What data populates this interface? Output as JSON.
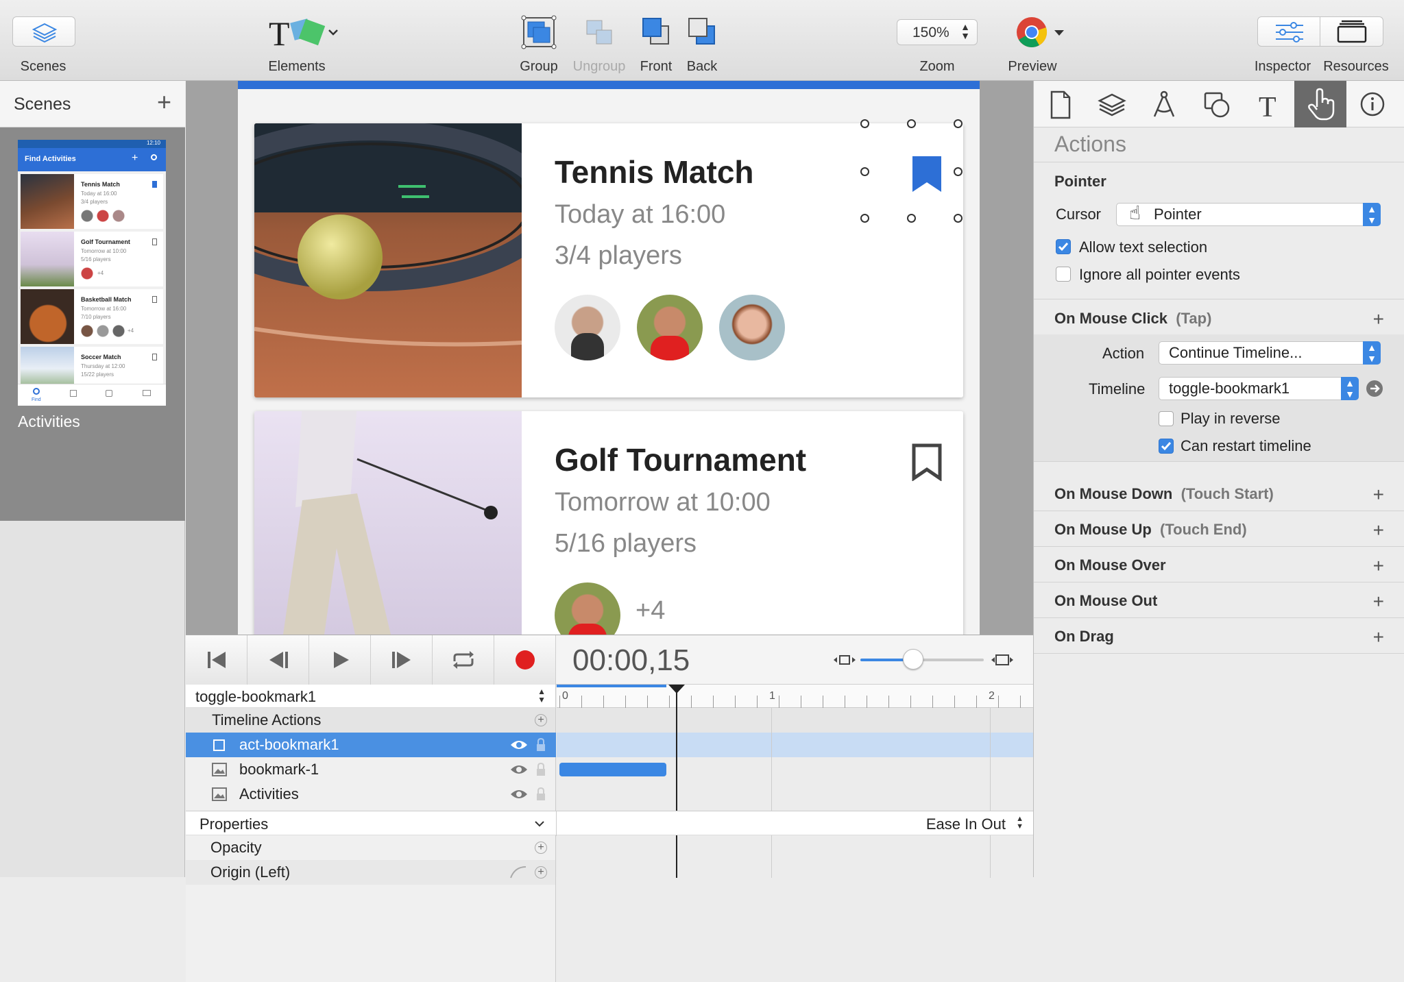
{
  "toolbar": {
    "scenes_label": "Scenes",
    "elements_label": "Elements",
    "group_label": "Group",
    "ungroup_label": "Ungroup",
    "front_label": "Front",
    "back_label": "Back",
    "zoom_value": "150%",
    "zoom_label": "Zoom",
    "preview_label": "Preview",
    "inspector_label": "Inspector",
    "resources_label": "Resources"
  },
  "scenes": {
    "header": "Scenes",
    "scene_name": "Activities",
    "thumb": {
      "time": "12:10",
      "title": "Find Activities",
      "items": [
        {
          "title": "Tennis Match",
          "line1": "Today at 16:00",
          "line2": "3/4 players"
        },
        {
          "title": "Golf Tournament",
          "line1": "Tomorrow at 10:00",
          "line2": "5/16 players"
        },
        {
          "title": "Basketball Match",
          "line1": "Tomorrow at 16:00",
          "line2": "7/10 players"
        },
        {
          "title": "Soccer Match",
          "line1": "Thursday at 12:00",
          "line2": "15/22 players"
        }
      ],
      "plus_more": "+4",
      "nav_find": "Find"
    }
  },
  "canvas": {
    "cards": [
      {
        "title": "Tennis Match",
        "time": "Today at 16:00",
        "players": "3/4 players"
      },
      {
        "title": "Golf Tournament",
        "time": "Tomorrow at 10:00",
        "players": "5/16 players",
        "extra": "+4"
      }
    ]
  },
  "timeline": {
    "timecode": "00:00,15",
    "timeline_name": "toggle-bookmark1",
    "ruler": [
      "0",
      "1",
      "2"
    ],
    "group": "Timeline Actions",
    "rows": [
      {
        "name": "act-bookmark1"
      },
      {
        "name": "bookmark-1"
      },
      {
        "name": "Activities"
      }
    ],
    "properties_label": "Properties",
    "easing": "Ease In Out",
    "props": [
      "Opacity",
      "Origin (Left)"
    ]
  },
  "inspector": {
    "title": "Actions",
    "pointer_section": "Pointer",
    "cursor_label": "Cursor",
    "cursor_value": "Pointer",
    "allow_text_selection": "Allow text selection",
    "ignore_pointer_events": "Ignore all pointer events",
    "on_click": "On Mouse Click",
    "on_click_paren": "(Tap)",
    "action_label": "Action",
    "action_value": "Continue Timeline...",
    "timeline_label": "Timeline",
    "timeline_value": "toggle-bookmark1",
    "play_reverse": "Play in reverse",
    "can_restart": "Can restart timeline",
    "on_down": "On Mouse Down",
    "on_down_paren": "(Touch Start)",
    "on_up": "On Mouse Up",
    "on_up_paren": "(Touch End)",
    "on_over": "On Mouse Over",
    "on_out": "On Mouse Out",
    "on_drag": "On Drag"
  },
  "colors": {
    "accent": "#3b87e3",
    "bookmark_blue": "#2d6fd6",
    "selection_row": "#4a90e2",
    "record_red": "#e02020"
  }
}
